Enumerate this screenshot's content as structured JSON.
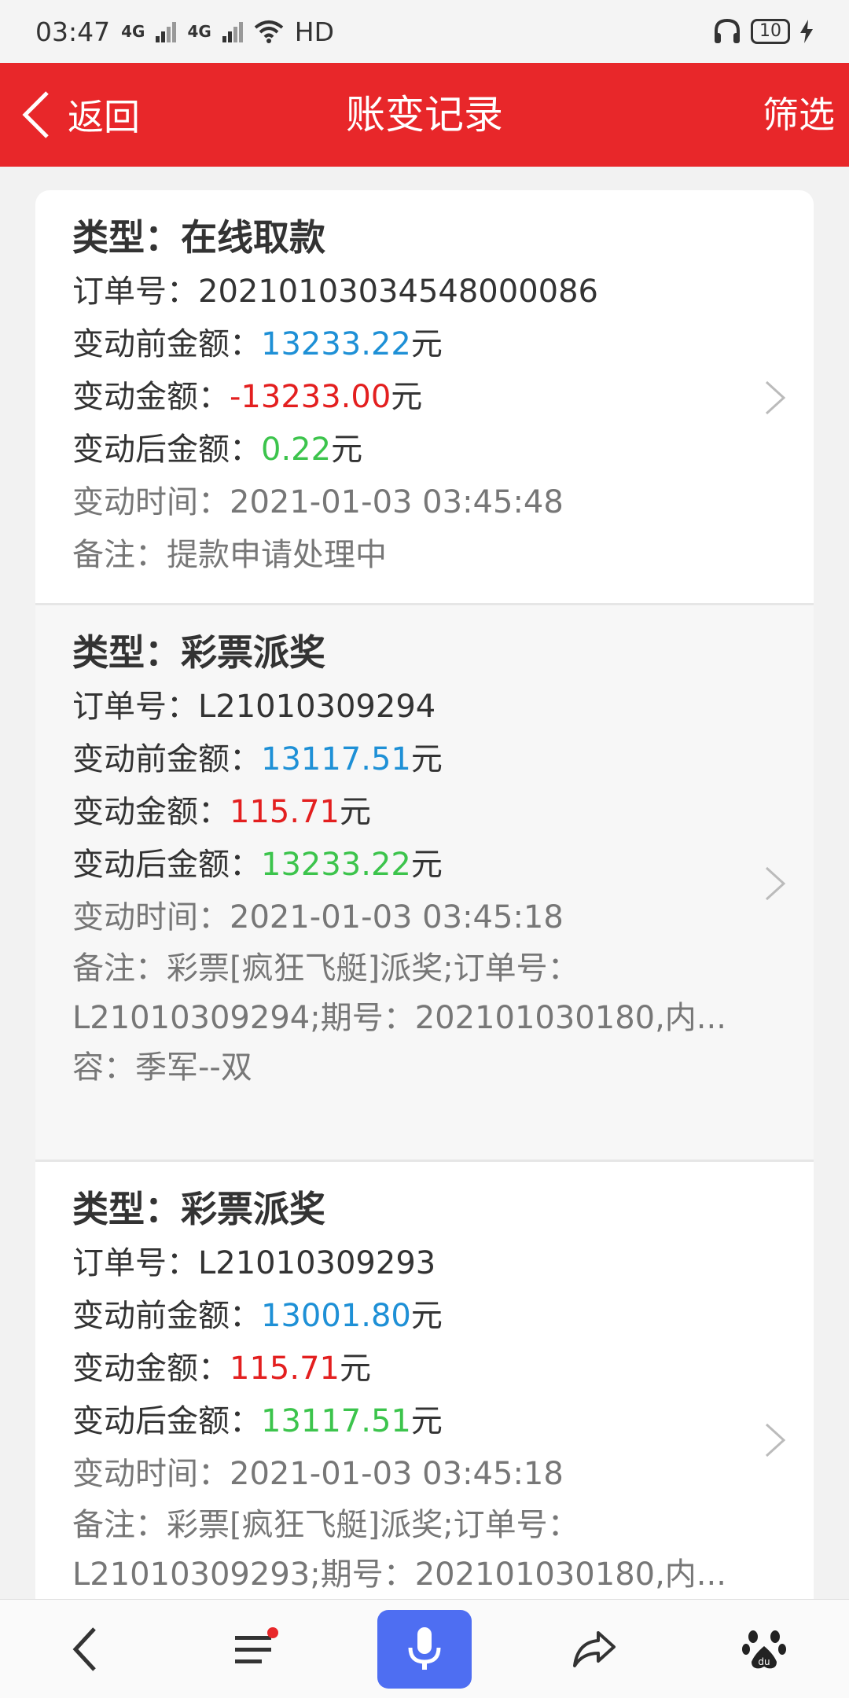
{
  "status_bar": {
    "time": "03:47",
    "signal1": "4G",
    "signal2": "4G",
    "hd": "HD",
    "battery": "10"
  },
  "header": {
    "back_label": "返回",
    "title": "账变记录",
    "filter_label": "筛选"
  },
  "colors": {
    "header_red": "#e8272a",
    "amount_before": "#1e90d6",
    "amount_change": "#e31f1f",
    "amount_after": "#3cc44c",
    "mic_blue": "#4e6ef2"
  },
  "records": [
    {
      "type_label": "类型：",
      "type": "在线取款",
      "order_label": "订单号：",
      "order": "20210103034548000086",
      "before_label": "变动前金额：",
      "before": "13233.22",
      "change_label": "变动金额：",
      "change": "-13233.00",
      "after_label": "变动后金额：",
      "after": "0.22",
      "unit": "元",
      "time_label": "变动时间：",
      "time": "2021-01-03 03:45:48",
      "remark_label": "备注：",
      "remark": "提款申请处理中"
    },
    {
      "type_label": "类型：",
      "type": "彩票派奖",
      "order_label": "订单号：",
      "order": "L21010309294",
      "before_label": "变动前金额：",
      "before": "13117.51",
      "change_label": "变动金额：",
      "change": "115.71",
      "after_label": "变动后金额：",
      "after": "13233.22",
      "unit": "元",
      "time_label": "变动时间：",
      "time": "2021-01-03 03:45:18",
      "remark_label": "备注：",
      "remark_line1": "彩票[疯狂飞艇]派奖;订单号：",
      "remark_line2": "L21010309294;期号：202101030180,内...",
      "remark_line3": "容：季军--双"
    },
    {
      "type_label": "类型：",
      "type": "彩票派奖",
      "order_label": "订单号：",
      "order": "L21010309293",
      "before_label": "变动前金额：",
      "before": "13001.80",
      "change_label": "变动金额：",
      "change": "115.71",
      "after_label": "变动后金额：",
      "after": "13117.51",
      "unit": "元",
      "time_label": "变动时间：",
      "time": "2021-01-03 03:45:18",
      "remark_label": "备注：",
      "remark_line1": "彩票[疯狂飞艇]派奖;订单号：",
      "remark_line2": "L21010309293;期号：202101030180,内..."
    }
  ],
  "bottom_nav": {
    "items": [
      "back-icon",
      "menu-icon",
      "mic-icon",
      "share-icon",
      "baidu-paw-icon"
    ]
  }
}
